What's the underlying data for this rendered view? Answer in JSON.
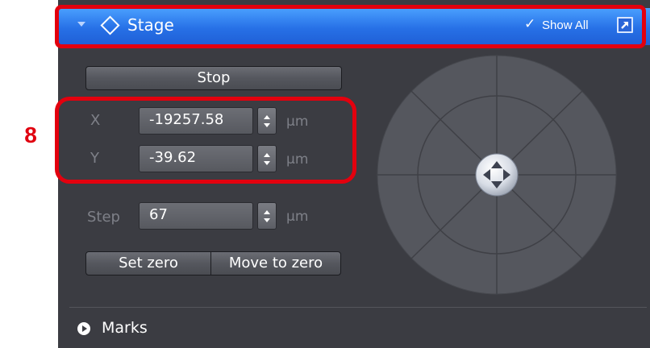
{
  "annotation": {
    "label": "8",
    "color": "#e3000e"
  },
  "header": {
    "title": "Stage",
    "show_all_check": "✓",
    "show_all_label": "Show All",
    "accent": "#2770e6"
  },
  "stop_button": "Stop",
  "fields": {
    "x": {
      "label": "X",
      "value": "-19257.58",
      "unit": "µm"
    },
    "y": {
      "label": "Y",
      "value": "-39.62",
      "unit": "µm"
    },
    "step": {
      "label": "Step",
      "value": "67",
      "unit": "µm"
    }
  },
  "buttons": {
    "set_zero": "Set zero",
    "move_to_zero": "Move to zero"
  },
  "marks": {
    "label": "Marks"
  },
  "icons": {
    "collapse": "chevron-down-icon",
    "stage": "diamond-icon",
    "popout": "popout-icon",
    "marks": "play-circle-icon",
    "joystick": "four-way-arrow-icon"
  }
}
